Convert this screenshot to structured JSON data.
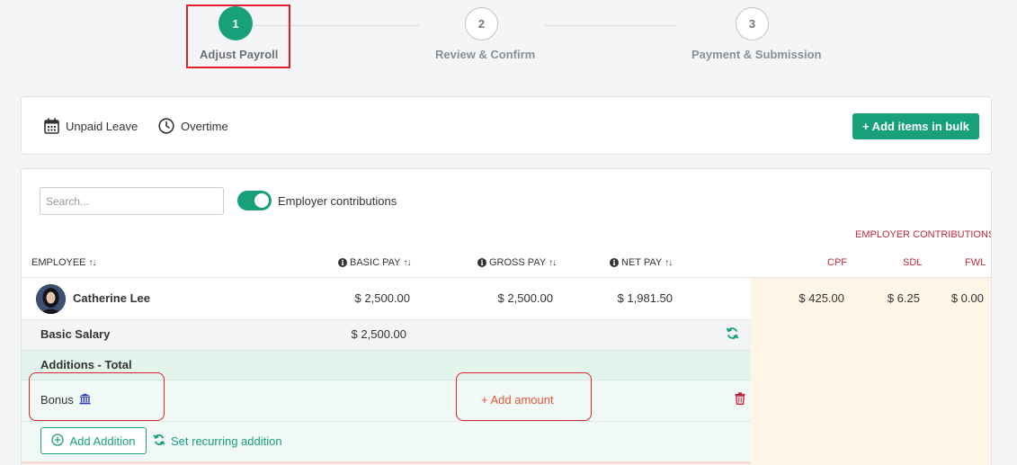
{
  "stepper": {
    "steps": [
      {
        "number": "1",
        "label": "Adjust Payroll"
      },
      {
        "number": "2",
        "label": "Review & Confirm"
      },
      {
        "number": "3",
        "label": "Payment & Submission"
      }
    ]
  },
  "toolbar": {
    "unpaid_leave": "Unpaid Leave",
    "overtime": "Overtime",
    "add_bulk": "+ Add items in bulk"
  },
  "table": {
    "search_placeholder": "Search...",
    "employer_toggle_label": "Employer contributions",
    "employer_contributions_heading": "EMPLOYER CONTRIBUTIONS",
    "columns": {
      "employee": "EMPLOYEE",
      "basic_pay": "BASIC PAY",
      "gross_pay": "GROSS PAY",
      "net_pay": "NET PAY",
      "cpf": "CPF",
      "sdl": "SDL",
      "fwl": "FWL"
    },
    "employee": {
      "name": "Catherine Lee",
      "basic_pay": "$ 2,500.00",
      "gross_pay": "$ 2,500.00",
      "net_pay": "$ 1,981.50",
      "cpf": "$ 425.00",
      "sdl": "$ 6.25",
      "fwl": "$ 0.00"
    },
    "basic_salary": {
      "label": "Basic Salary",
      "amount": "$ 2,500.00"
    },
    "additions_total": "Additions - Total",
    "bonus": {
      "label": "Bonus",
      "add_amount": "+ Add amount"
    },
    "add_addition": "Add Addition",
    "set_recurring": "Set recurring addition"
  },
  "colors": {
    "accent": "#17a07a",
    "employer_red": "#c0263a",
    "highlight": "#e0202a",
    "employer_bg": "#fff5e6",
    "additions_bg": "#e8f5ef"
  }
}
